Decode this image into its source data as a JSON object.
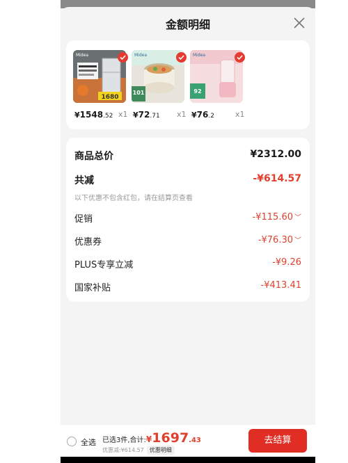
{
  "sheet": {
    "title": "金额明细"
  },
  "products": [
    {
      "currency": "¥",
      "price_int": "1548",
      "price_dec": ".52",
      "qty": "x1",
      "brand": "Midea",
      "tag": "1680"
    },
    {
      "currency": "¥",
      "price_int": "72",
      "price_dec": ".71",
      "qty": "x1",
      "brand": "Midea",
      "tag": "101"
    },
    {
      "currency": "¥",
      "price_int": "76",
      "price_dec": ".2",
      "qty": "x1",
      "brand": "Midea",
      "tag": "92"
    }
  ],
  "details": {
    "total_label": "商品总价",
    "total_value": "¥2312.00",
    "reduce_label": "共减",
    "reduce_value": "-¥614.57",
    "note": "以下优惠不包含红包，请在结算页查看",
    "promo_label": "促销",
    "promo_value": "-¥115.60",
    "coupon_label": "优惠券",
    "coupon_value": "-¥76.30",
    "plus_label": "PLUS专享立减",
    "plus_value": "-¥9.26",
    "subsidy_label": "国家补贴",
    "subsidy_value": "-¥413.41"
  },
  "bottom": {
    "select_all": "全选",
    "selected_text": "已选3件,合计:",
    "amount_symbol": "¥",
    "amount_int": "1697",
    "amount_dec": ".43",
    "discount_text": "优惠减:¥614.57",
    "detail_tag": "优惠明细",
    "checkout": "去结算"
  },
  "colors": {
    "accent": "#e02e24",
    "discount": "#e0402e"
  }
}
